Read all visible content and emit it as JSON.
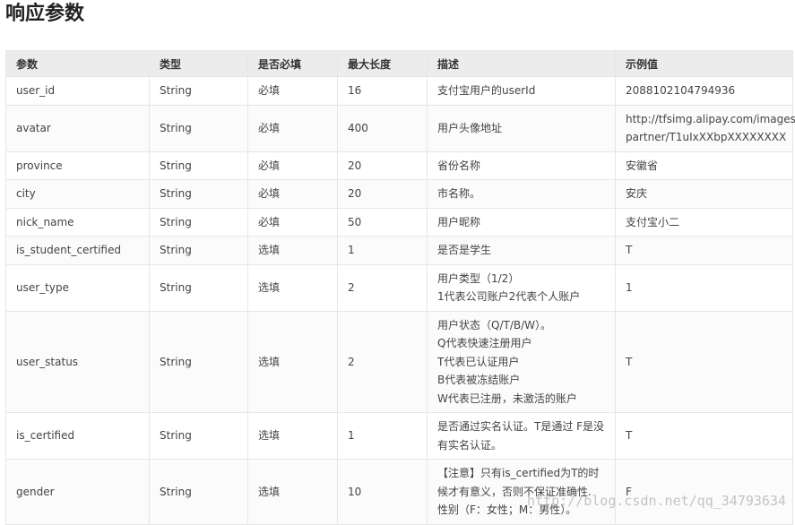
{
  "page": {
    "title": "响应参数"
  },
  "table": {
    "headers": [
      "参数",
      "类型",
      "是否必填",
      "最大长度",
      "描述",
      "示例值"
    ],
    "rows": [
      {
        "param": "user_id",
        "type": "String",
        "required": "必填",
        "maxlen": "16",
        "desc": [
          "支付宝用户的userId"
        ],
        "example": [
          "2088102104794936"
        ]
      },
      {
        "param": "avatar",
        "type": "String",
        "required": "必填",
        "maxlen": "400",
        "desc": [
          "用户头像地址"
        ],
        "example": [
          "http://tfsimg.alipay.com/images/",
          "partner/T1uIxXXbpXXXXXXXX"
        ]
      },
      {
        "param": "province",
        "type": "String",
        "required": "必填",
        "maxlen": "20",
        "desc": [
          "省份名称"
        ],
        "example": [
          "安徽省"
        ]
      },
      {
        "param": "city",
        "type": "String",
        "required": "必填",
        "maxlen": "20",
        "desc": [
          "市名称。"
        ],
        "example": [
          "安庆"
        ]
      },
      {
        "param": "nick_name",
        "type": "String",
        "required": "必填",
        "maxlen": "50",
        "desc": [
          "用户昵称"
        ],
        "example": [
          "支付宝小二"
        ]
      },
      {
        "param": "is_student_certified",
        "type": "String",
        "required": "选填",
        "maxlen": "1",
        "desc": [
          "是否是学生"
        ],
        "example": [
          "T"
        ]
      },
      {
        "param": "user_type",
        "type": "String",
        "required": "选填",
        "maxlen": "2",
        "desc": [
          "用户类型（1/2）",
          "1代表公司账户2代表个人账户"
        ],
        "example": [
          "1"
        ]
      },
      {
        "param": "user_status",
        "type": "String",
        "required": "选填",
        "maxlen": "2",
        "desc": [
          "用户状态（Q/T/B/W）。",
          "Q代表快速注册用户",
          "T代表已认证用户",
          "B代表被冻结账户",
          "W代表已注册，未激活的账户"
        ],
        "example": [
          "T"
        ]
      },
      {
        "param": "is_certified",
        "type": "String",
        "required": "选填",
        "maxlen": "1",
        "desc": [
          "是否通过实名认证。T是通过 F是没",
          "有实名认证。"
        ],
        "example": [
          "T"
        ]
      },
      {
        "param": "gender",
        "type": "String",
        "required": "选填",
        "maxlen": "10",
        "desc": [
          "【注意】只有is_certified为T的时",
          "候才有意义，否则不保证准确性.",
          "性别（F：女性；M：男性）。"
        ],
        "example": [
          "F"
        ]
      }
    ]
  },
  "watermark": "http://blog.csdn.net/qq_34793634"
}
